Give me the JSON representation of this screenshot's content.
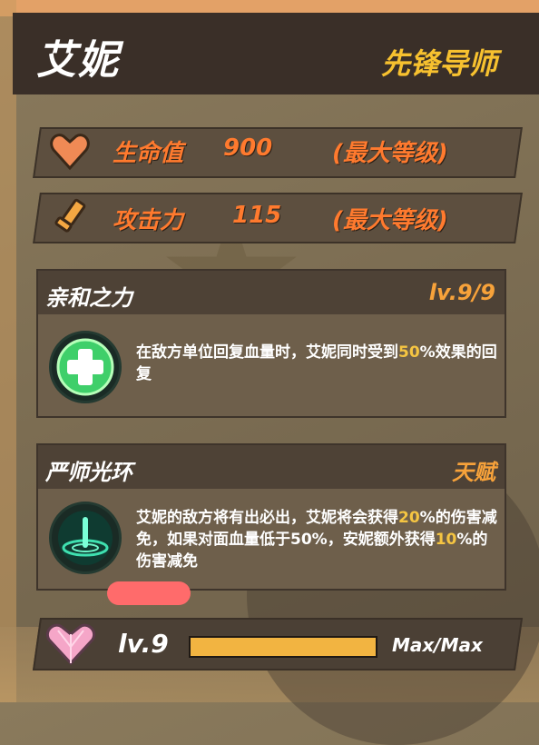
{
  "header": {
    "name": "艾妮",
    "title": "先锋导师"
  },
  "stats": [
    {
      "label": "生命值",
      "value": "900",
      "note": "(最大等级)",
      "icon": "heart-icon"
    },
    {
      "label": "攻击力",
      "value": "115",
      "note": "(最大等级)",
      "icon": "sword-icon"
    }
  ],
  "skills": [
    {
      "title": "亲和之力",
      "tag": "lv.9/9",
      "icon": "heal-cross-icon",
      "desc_a": "在敌方单位回复血量时，艾妮同时受到",
      "desc_hl": "50",
      "desc_b": "%效果的回复"
    },
    {
      "title": "严师光环",
      "tag": "天赋",
      "icon": "aura-icon",
      "desc_a": "艾妮的敌方将有出必出，艾妮将会获得",
      "desc_hl": "20",
      "desc_b": "%的伤害减免，如果对面血量低于50%，安妮额外获得",
      "desc_hl2": "10",
      "desc_c": "%的伤害减免"
    }
  ],
  "level": {
    "label": "lv.9",
    "progress": 1.0,
    "max_text": "Max/Max",
    "icon": "pink-crystal-heart-icon"
  },
  "colors": {
    "accent_gold": "#f7c12f",
    "stat_orange": "#ff7a2e",
    "highlight": "#f5c542",
    "progress": "#f2b441"
  }
}
